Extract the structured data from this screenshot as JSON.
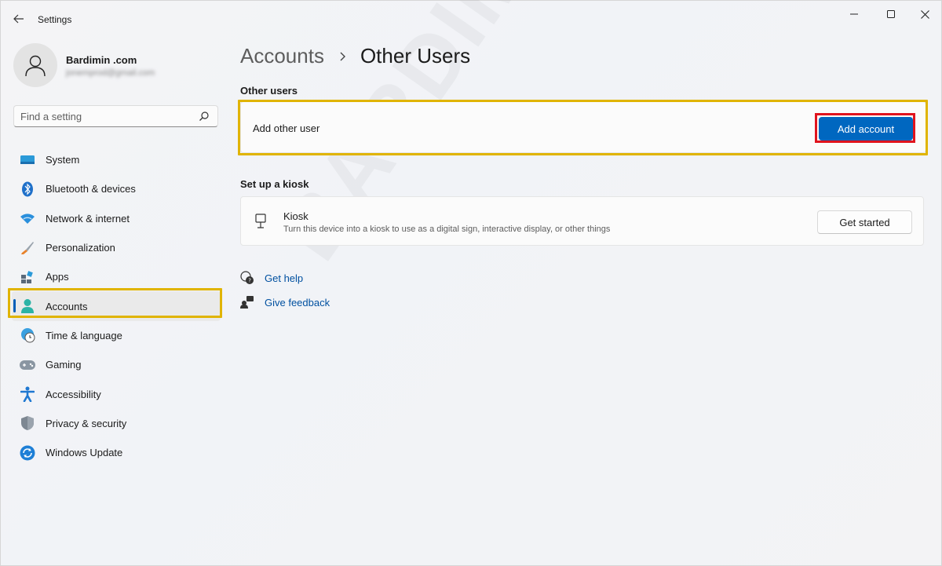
{
  "window": {
    "title": "Settings"
  },
  "profile": {
    "name": "Bardimin .com",
    "email": "jonemprod@gmail.com"
  },
  "search": {
    "placeholder": "Find a setting"
  },
  "sidebar": {
    "items": [
      {
        "label": "System",
        "icon": "monitor-icon"
      },
      {
        "label": "Bluetooth & devices",
        "icon": "bluetooth-icon"
      },
      {
        "label": "Network & internet",
        "icon": "wifi-icon"
      },
      {
        "label": "Personalization",
        "icon": "brush-icon"
      },
      {
        "label": "Apps",
        "icon": "apps-icon"
      },
      {
        "label": "Accounts",
        "icon": "person-icon",
        "selected": true
      },
      {
        "label": "Time & language",
        "icon": "globe-clock-icon"
      },
      {
        "label": "Gaming",
        "icon": "gamepad-icon"
      },
      {
        "label": "Accessibility",
        "icon": "accessibility-icon"
      },
      {
        "label": "Privacy & security",
        "icon": "shield-icon"
      },
      {
        "label": "Windows Update",
        "icon": "update-icon"
      }
    ]
  },
  "breadcrumb": {
    "parent": "Accounts",
    "current": "Other Users"
  },
  "other_users": {
    "heading": "Other users",
    "add_label": "Add other user",
    "add_button": "Add account"
  },
  "kiosk": {
    "heading": "Set up a kiosk",
    "title": "Kiosk",
    "description": "Turn this device into a kiosk to use as a digital sign, interactive display, or other things",
    "button": "Get started"
  },
  "links": {
    "help": "Get help",
    "feedback": "Give feedback"
  },
  "watermark": "BARDIMIN",
  "colors": {
    "accent": "#0067c0",
    "highlight_yellow": "#e0b400",
    "highlight_red": "#e0141e"
  }
}
